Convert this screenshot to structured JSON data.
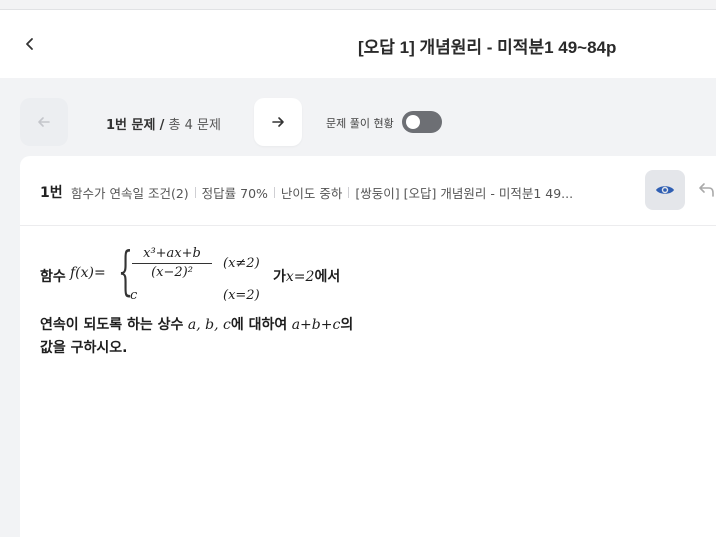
{
  "header": {
    "title": "[오답 1] 개념원리 - 미적분1 49~84p"
  },
  "nav": {
    "current": "1번 문제",
    "divider": "/",
    "total": "총 4 문제",
    "status_label": "문제 풀이 현황",
    "status_toggle_on": false
  },
  "question": {
    "number": "1번",
    "meta": [
      "함수가 연속일 조건(2)",
      "정답률 70%",
      "난이도 중하",
      "[쌍둥이] [오답] 개념원리 - 미적분1 49..."
    ],
    "body": {
      "lead": "함수",
      "fx": "f(x)=",
      "numerator": "x³+ax+b",
      "denominator": "(x−2)²",
      "cond1": "(x≠2)",
      "case2_value": "c",
      "cond2": "(x=2)",
      "after_ga": "가",
      "at_point": "x=2",
      "eseo": "에서",
      "line2_pre": "연속이 되도록 하는 상수",
      "constants": "a, b, c",
      "line2_mid": "에 대하여",
      "sum_expr": "a+b+c",
      "line2_post": "의",
      "line3": "값을 구하시오."
    }
  },
  "icons": {
    "back": "chevron-left-icon",
    "prev": "arrow-left-icon",
    "next": "arrow-right-icon",
    "eye": "eye-icon",
    "undo": "undo-icon"
  },
  "colors": {
    "accent": "#2f5fb3",
    "toggle_off": "#6d6f74"
  }
}
